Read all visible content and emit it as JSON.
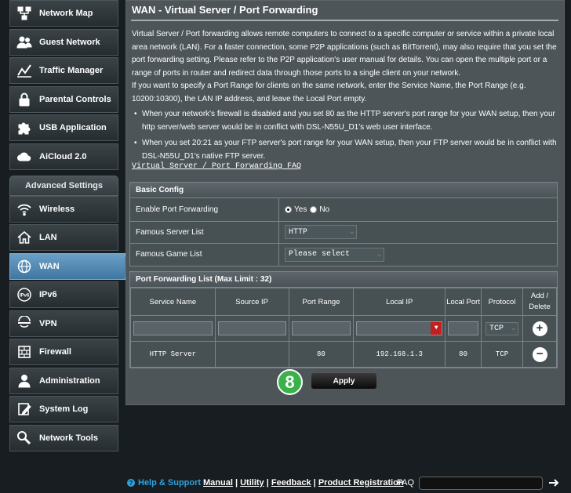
{
  "sidebar": {
    "general_items": [
      {
        "label": "Network Map",
        "icon": "network-map-icon"
      },
      {
        "label": "Guest Network",
        "icon": "guest-network-icon"
      },
      {
        "label": "Traffic Manager",
        "icon": "traffic-manager-icon"
      },
      {
        "label": "Parental Controls",
        "icon": "lock-icon"
      },
      {
        "label": "USB Application",
        "icon": "puzzle-icon"
      },
      {
        "label": "AiCloud 2.0",
        "icon": "cloud-icon"
      }
    ],
    "advanced_header": "Advanced Settings",
    "advanced_items": [
      {
        "label": "Wireless",
        "icon": "wifi-icon"
      },
      {
        "label": "LAN",
        "icon": "home-icon"
      },
      {
        "label": "WAN",
        "icon": "globe-icon",
        "active": true
      },
      {
        "label": "IPv6",
        "icon": "ipv6-icon"
      },
      {
        "label": "VPN",
        "icon": "vpn-icon"
      },
      {
        "label": "Firewall",
        "icon": "firewall-icon"
      },
      {
        "label": "Administration",
        "icon": "administration-icon"
      },
      {
        "label": "System Log",
        "icon": "system-log-icon"
      },
      {
        "label": "Network Tools",
        "icon": "network-tools-icon"
      }
    ]
  },
  "main": {
    "title": "WAN - Virtual Server / Port Forwarding",
    "description": "Virtual Server / Port forwarding allows remote computers to connect to a specific computer or service within a private local area network (LAN). For a faster connection, some P2P applications (such as BitTorrent), may also require that you set the port forwarding setting. Please refer to the P2P application's user manual for details. You can open the multiple port or a range of ports in router and redirect data through those ports to a single client on your network.",
    "range_note": "If you want to specify a Port Range for clients on the same network, enter the Service Name, the Port Range (e.g. 10200:10300), the LAN IP address, and leave the Local Port empty.",
    "bullet1": "When your network's firewall is disabled and you set 80 as the HTTP server's port range for your WAN setup, then your http server/web server would be in conflict with DSL-N55U_D1's web user interface.",
    "bullet2": "When you set 20:21 as your FTP server's port range for your WAN setup, then your FTP server would be in conflict with DSL-N55U_D1's native FTP server.",
    "faq_link": "Virtual Server / Port Forwarding FAQ"
  },
  "basic_config": {
    "header": "Basic Config",
    "enable_label": "Enable Port Forwarding",
    "yes": "Yes",
    "no": "No",
    "enabled": true,
    "server_label": "Famous Server List",
    "server_value": "HTTP",
    "game_label": "Famous Game List",
    "game_value": "Please select"
  },
  "port_list": {
    "header": "Port Forwarding List (Max Limit : 32)",
    "columns": [
      "Service Name",
      "Source IP",
      "Port Range",
      "Local IP",
      "Local Port",
      "Protocol",
      "Add / Delete"
    ],
    "new_protocol": "TCP",
    "rows": [
      {
        "service": "HTTP Server",
        "source_ip": "",
        "port_range": "80",
        "local_ip": "192.168.1.3",
        "local_port": "80",
        "protocol": "TCP"
      }
    ]
  },
  "step_badge": "8",
  "apply_label": "Apply",
  "footer": {
    "help": "Help & Support",
    "manual": "Manual",
    "utility": "Utility",
    "feedback": "Feedback",
    "registration": "Product Registration",
    "faq": "FAQ"
  }
}
